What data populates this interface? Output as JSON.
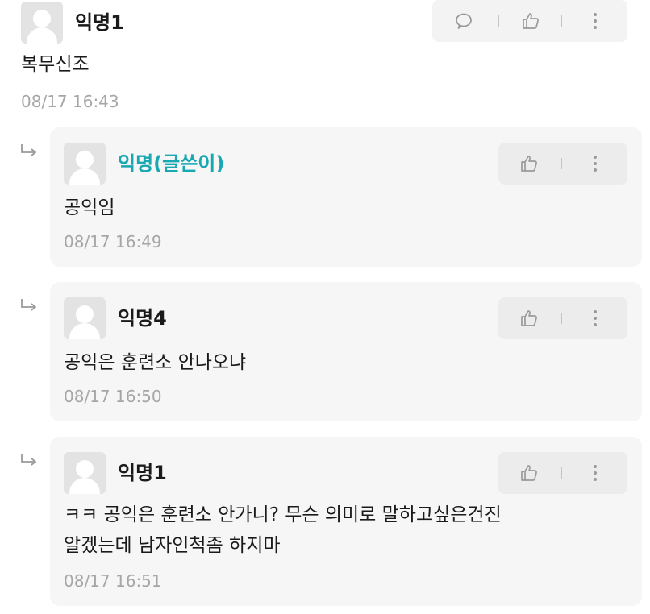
{
  "root_comment": {
    "nickname": "익명1",
    "content": "복무신조",
    "time": "08/17 16:43",
    "actions": [
      "comment-icon",
      "thumbs-up-icon",
      "more-vertical-icon"
    ]
  },
  "replies": [
    {
      "nickname": "익명(글쓴이)",
      "is_author": true,
      "content_lines": [
        "공익임"
      ],
      "time": "08/17 16:49"
    },
    {
      "nickname": "익명4",
      "is_author": false,
      "content_lines": [
        "공익은 훈련소 안나오냐"
      ],
      "time": "08/17 16:50"
    },
    {
      "nickname": "익명1",
      "is_author": false,
      "content_lines": [
        "ㅋㅋ 공익은 훈련소 안가니? 무슨 의미로 말하고싶은건진",
        "알겠는데 남자인척좀 하지마"
      ],
      "time": "08/17 16:51"
    }
  ],
  "colors": {
    "author": "#17a8b2",
    "time": "#a6a6a6",
    "card_bg": "#f6f6f6"
  }
}
